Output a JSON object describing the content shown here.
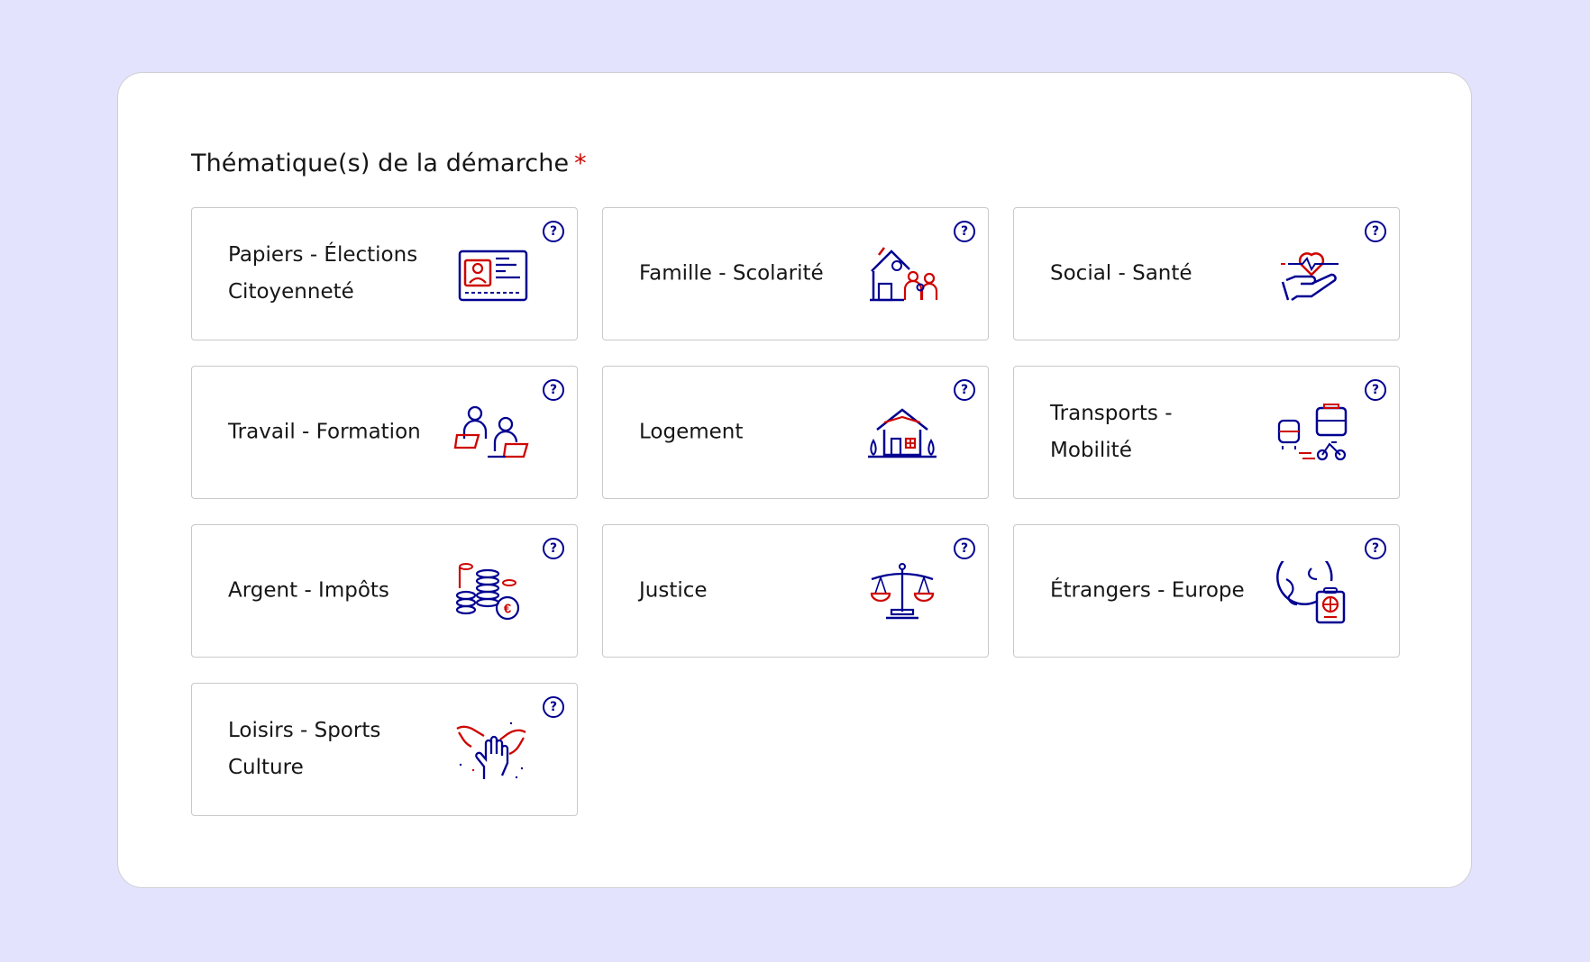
{
  "form": {
    "title": "Thématique(s) de la démarche",
    "required_mark": "*"
  },
  "help_symbol": "?",
  "colors": {
    "accent": "#000091",
    "red": "#ce0500",
    "background": "#e3e3fd"
  },
  "themes": [
    {
      "label": "Papiers  - Élections\nCitoyenneté",
      "icon": "id-card-icon"
    },
    {
      "label": "Famille - Scolarité",
      "icon": "family-school-icon"
    },
    {
      "label": "Social - Santé",
      "icon": "heart-hand-icon"
    },
    {
      "label": "Travail - Formation",
      "icon": "work-laptop-icon"
    },
    {
      "label": "Logement",
      "icon": "house-icon"
    },
    {
      "label": "Transports -\nMobilité",
      "icon": "transport-icon"
    },
    {
      "label": "Argent - Impôts",
      "icon": "coins-euro-icon"
    },
    {
      "label": "Justice",
      "icon": "scales-icon"
    },
    {
      "label": "Étrangers - Europe",
      "icon": "globe-passport-icon"
    },
    {
      "label": "Loisirs - Sports\nCulture",
      "icon": "hands-icon"
    }
  ]
}
